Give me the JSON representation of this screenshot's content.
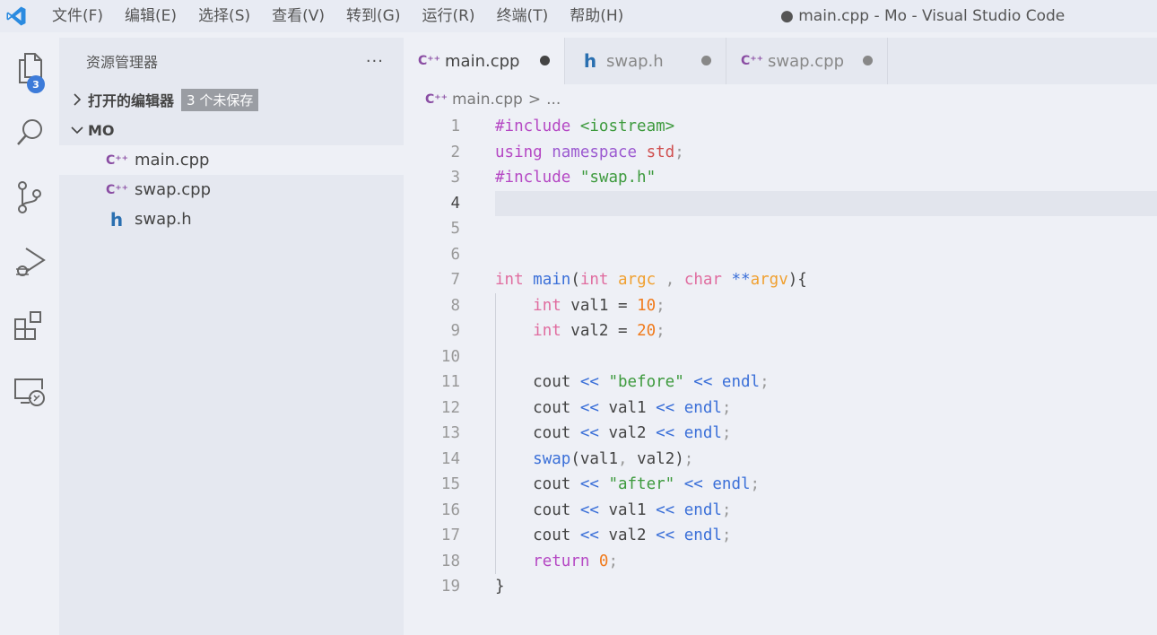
{
  "titlebar": {
    "menu": [
      "文件(F)",
      "编辑(E)",
      "选择(S)",
      "查看(V)",
      "转到(G)",
      "运行(R)",
      "终端(T)",
      "帮助(H)"
    ],
    "window_title": "● main.cpp - Mo - Visual Studio Code"
  },
  "activitybar": {
    "explorer_badge": "3"
  },
  "sidebar": {
    "title": "资源管理器",
    "more": "···",
    "open_editors_label": "打开的编辑器",
    "unsaved_badge": "3 个未保存",
    "folder_label": "MO",
    "files": [
      {
        "name": "main.cpp",
        "icon": "cpp"
      },
      {
        "name": "swap.cpp",
        "icon": "cpp"
      },
      {
        "name": "swap.h",
        "icon": "h"
      }
    ]
  },
  "tabs": [
    {
      "name": "main.cpp",
      "icon": "cpp"
    },
    {
      "name": "swap.h",
      "icon": "h"
    },
    {
      "name": "swap.cpp",
      "icon": "cpp"
    }
  ],
  "icons": {
    "cpp": "C⁺⁺",
    "h": "h"
  },
  "breadcrumb": {
    "file": "main.cpp",
    "sep": ">",
    "more": "..."
  },
  "editor": {
    "line_numbers": [
      "1",
      "2",
      "3",
      "4",
      "5",
      "6",
      "7",
      "8",
      "9",
      "10",
      "11",
      "12",
      "13",
      "14",
      "15",
      "16",
      "17",
      "18",
      "19"
    ],
    "current_line": "4",
    "lines": [
      "#include <iostream>",
      "using namespace std;",
      "#include \"swap.h\"",
      "",
      "",
      "",
      "int main(int argc , char **argv){",
      "    int val1 = 10;",
      "    int val2 = 20;",
      "",
      "    cout << \"before\" << endl;",
      "    cout << val1 << endl;",
      "    cout << val2 << endl;",
      "    swap(val1, val2);",
      "    cout << \"after\" << endl;",
      "    cout << val1 << endl;",
      "    cout << val2 << endl;",
      "    return 0;",
      "}"
    ]
  }
}
